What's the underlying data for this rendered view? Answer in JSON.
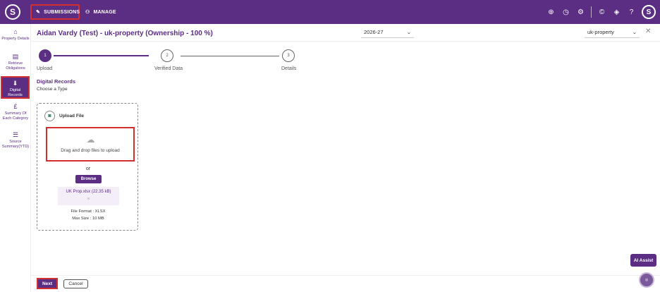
{
  "topbar": {
    "logo": "S",
    "nav": [
      {
        "label": "SUBMISSIONS",
        "icon": "pencil-icon"
      },
      {
        "label": "MANAGE",
        "icon": "users-icon"
      }
    ],
    "avatar": "S"
  },
  "sidebar": {
    "items": [
      {
        "label": "Property Details",
        "icon": "home-icon"
      },
      {
        "label": "Retrieve Obligations",
        "icon": "document-icon"
      },
      {
        "label": "Digital Records",
        "icon": "download-icon"
      },
      {
        "label": "Summary Of Each Category",
        "icon": "pound-icon"
      },
      {
        "label": "Source Summary(YTD)",
        "icon": "list-icon"
      }
    ]
  },
  "header": {
    "title": "Aidan Vardy (Test) - uk-property (Ownership - 100 %)",
    "year": "2026-27",
    "property": "uk-property"
  },
  "stepper": {
    "steps": [
      {
        "number": "1",
        "label": "Upload"
      },
      {
        "number": "2",
        "label": "Verified Data"
      },
      {
        "number": "3",
        "label": "Details"
      }
    ]
  },
  "section": {
    "title": "Digital Records",
    "subtitle": "Choose a Type"
  },
  "upload": {
    "label": "Upload File",
    "drop_text": "Drag and drop files to upload",
    "or": "or",
    "browse": "Browse",
    "file_name": "UK Prop.xlsx (22.35 kB)",
    "remove": "×",
    "format": "File Format : XLSX",
    "max_size": "Max Size : 10 MB"
  },
  "footer": {
    "next": "Next",
    "cancel": "Cancel"
  },
  "assist": {
    "label": "AI Assist"
  },
  "colors": {
    "brand": "#5b2e83",
    "highlight": "#d32f2f"
  }
}
